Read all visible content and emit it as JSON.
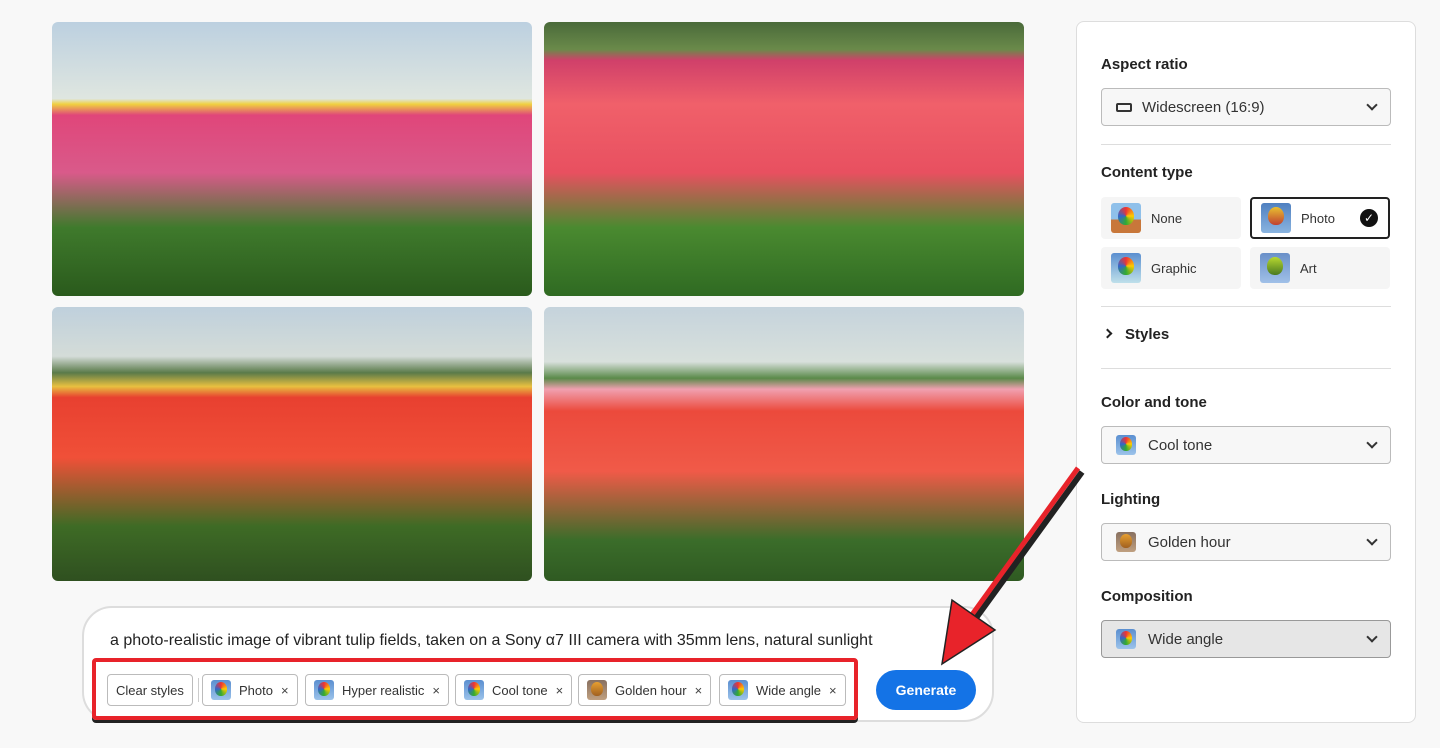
{
  "gallery": {
    "images": [
      {
        "name": "tulip-image-1",
        "colors": [
          "#cfdce8",
          "#e0467a",
          "#2f6a24"
        ]
      },
      {
        "name": "tulip-image-2",
        "colors": [
          "#4f7a3a",
          "#ea4d5e",
          "#3a7a2a"
        ]
      },
      {
        "name": "tulip-image-3",
        "colors": [
          "#c9d6de",
          "#e8402e",
          "#3e6b25"
        ]
      },
      {
        "name": "tulip-image-4",
        "colors": [
          "#c5d3dc",
          "#ec4a3c",
          "#3b6d2a"
        ]
      }
    ]
  },
  "panel": {
    "aspect_ratio": {
      "label": "Aspect ratio",
      "value": "Widescreen (16:9)"
    },
    "content_type": {
      "label": "Content type",
      "options": [
        "None",
        "Photo",
        "Graphic",
        "Art"
      ],
      "selected": "Photo"
    },
    "styles": {
      "label": "Styles"
    },
    "color_tone": {
      "label": "Color and tone",
      "value": "Cool tone"
    },
    "lighting": {
      "label": "Lighting",
      "value": "Golden hour"
    },
    "composition": {
      "label": "Composition",
      "value": "Wide angle"
    }
  },
  "prompt": {
    "text": "a photo-realistic image of vibrant tulip fields, taken on a Sony α7 III camera with 35mm lens, natural sunlight",
    "clear_label": "Clear styles",
    "chips": [
      "Photo",
      "Hyper realistic",
      "Cool tone",
      "Golden hour",
      "Wide angle"
    ],
    "remove_glyph": "×",
    "generate_label": "Generate"
  },
  "colors": {
    "accent": "#1473e6",
    "annotation": "#e8232a"
  }
}
